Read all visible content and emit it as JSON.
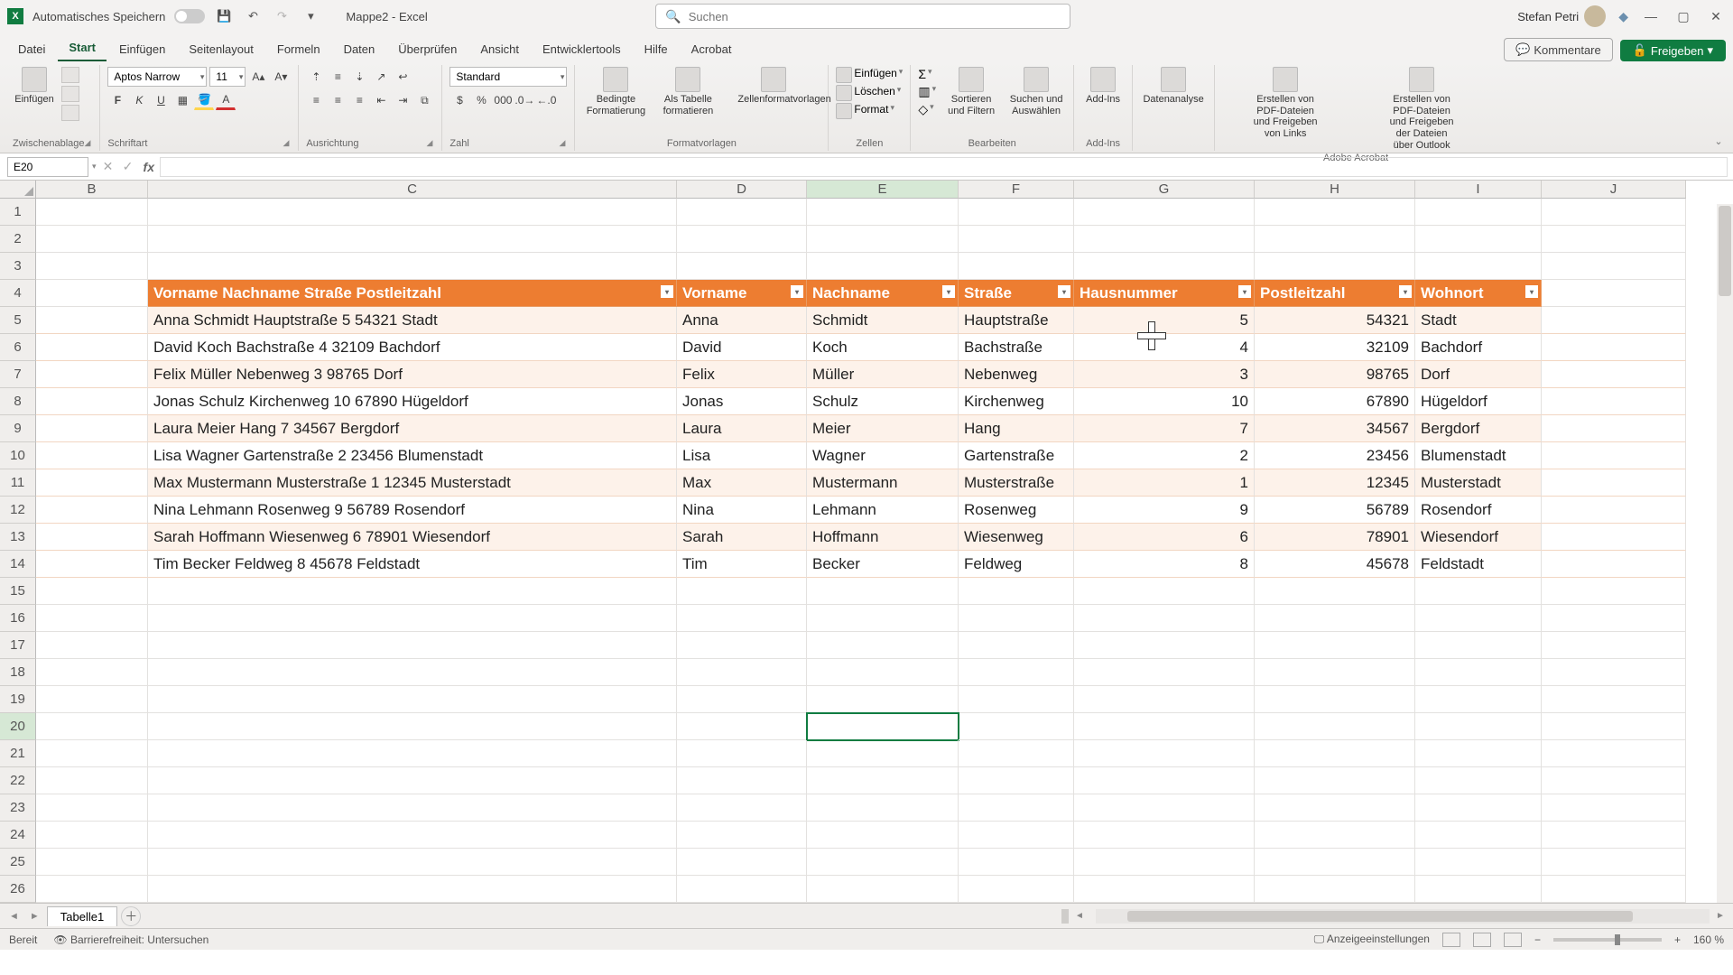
{
  "titlebar": {
    "autosave": "Automatisches Speichern",
    "doc_title": "Mappe2 - Excel",
    "search_placeholder": "Suchen",
    "user": "Stefan Petri"
  },
  "tabs": {
    "file": "Datei",
    "home": "Start",
    "insert": "Einfügen",
    "pagelayout": "Seitenlayout",
    "formulas": "Formeln",
    "data": "Daten",
    "review": "Überprüfen",
    "view": "Ansicht",
    "developer": "Entwicklertools",
    "help": "Hilfe",
    "acrobat": "Acrobat",
    "comments": "Kommentare",
    "share": "Freigeben"
  },
  "ribbon": {
    "clipboard": {
      "paste": "Einfügen",
      "label": "Zwischenablage"
    },
    "font": {
      "name": "Aptos Narrow",
      "size": "11",
      "label": "Schriftart"
    },
    "alignment": {
      "label": "Ausrichtung"
    },
    "number": {
      "format": "Standard",
      "label": "Zahl"
    },
    "styles": {
      "cond": "Bedingte Formatierung",
      "table": "Als Tabelle formatieren",
      "cellstyles": "Zellenformatvorlagen",
      "label": "Formatvorlagen"
    },
    "cells": {
      "insert": "Einfügen",
      "delete": "Löschen",
      "format": "Format",
      "label": "Zellen"
    },
    "editing": {
      "sortfilter": "Sortieren und Filtern",
      "findselect": "Suchen und Auswählen",
      "label": "Bearbeiten"
    },
    "addins": {
      "addins": "Add-Ins",
      "label": "Add-Ins"
    },
    "analysis": {
      "data_analyze": "Datenanalyse"
    },
    "acrobat": {
      "create_share": "Erstellen von PDF-Dateien und Freigeben von Links",
      "create_outlook": "Erstellen von PDF-Dateien und Freigeben der Dateien über Outlook",
      "label": "Adobe Acrobat"
    }
  },
  "namebox": {
    "ref": "E20"
  },
  "columns": [
    "B",
    "C",
    "D",
    "E",
    "F",
    "G",
    "H",
    "I",
    "J"
  ],
  "rows_shown": 26,
  "table_headers": {
    "combined": "Vorname Nachname Straße Postleitzahl",
    "vorname": "Vorname",
    "nachname": "Nachname",
    "strasse": "Straße",
    "hausnummer": "Hausnummer",
    "plz": "Postleitzahl",
    "wohnort": "Wohnort"
  },
  "table_rows": [
    {
      "combined": "Anna Schmidt Hauptstraße 5 54321 Stadt",
      "vorname": "Anna",
      "nachname": "Schmidt",
      "strasse": "Hauptstraße",
      "hausnummer": "5",
      "plz": "54321",
      "wohnort": "Stadt"
    },
    {
      "combined": "David Koch Bachstraße 4 32109 Bachdorf",
      "vorname": "David",
      "nachname": "Koch",
      "strasse": "Bachstraße",
      "hausnummer": "4",
      "plz": "32109",
      "wohnort": "Bachdorf"
    },
    {
      "combined": "Felix Müller Nebenweg 3 98765 Dorf",
      "vorname": "Felix",
      "nachname": "Müller",
      "strasse": "Nebenweg",
      "hausnummer": "3",
      "plz": "98765",
      "wohnort": "Dorf"
    },
    {
      "combined": "Jonas Schulz Kirchenweg 10 67890 Hügeldorf",
      "vorname": "Jonas",
      "nachname": "Schulz",
      "strasse": "Kirchenweg",
      "hausnummer": "10",
      "plz": "67890",
      "wohnort": "Hügeldorf"
    },
    {
      "combined": "Laura Meier Hang 7 34567 Bergdorf",
      "vorname": "Laura",
      "nachname": "Meier",
      "strasse": "Hang",
      "hausnummer": "7",
      "plz": "34567",
      "wohnort": "Bergdorf"
    },
    {
      "combined": "Lisa Wagner Gartenstraße 2 23456 Blumenstadt",
      "vorname": "Lisa",
      "nachname": "Wagner",
      "strasse": "Gartenstraße",
      "hausnummer": "2",
      "plz": "23456",
      "wohnort": "Blumenstadt"
    },
    {
      "combined": "Max Mustermann Musterstraße 1 12345 Musterstadt",
      "vorname": "Max",
      "nachname": "Mustermann",
      "strasse": "Musterstraße",
      "hausnummer": "1",
      "plz": "12345",
      "wohnort": "Musterstadt"
    },
    {
      "combined": "Nina Lehmann Rosenweg 9 56789 Rosendorf",
      "vorname": "Nina",
      "nachname": "Lehmann",
      "strasse": "Rosenweg",
      "hausnummer": "9",
      "plz": "56789",
      "wohnort": "Rosendorf"
    },
    {
      "combined": "Sarah Hoffmann Wiesenweg 6 78901 Wiesendorf",
      "vorname": "Sarah",
      "nachname": "Hoffmann",
      "strasse": "Wiesenweg",
      "hausnummer": "6",
      "plz": "78901",
      "wohnort": "Wiesendorf"
    },
    {
      "combined": "Tim Becker Feldweg 8 45678 Feldstadt",
      "vorname": "Tim",
      "nachname": "Becker",
      "strasse": "Feldweg",
      "hausnummer": "8",
      "plz": "45678",
      "wohnort": "Feldstadt"
    }
  ],
  "sheet": {
    "name": "Tabelle1"
  },
  "status": {
    "ready": "Bereit",
    "accessibility": "Barrierefreiheit: Untersuchen",
    "display": "Anzeigeeinstellungen",
    "zoom": "160 %"
  }
}
